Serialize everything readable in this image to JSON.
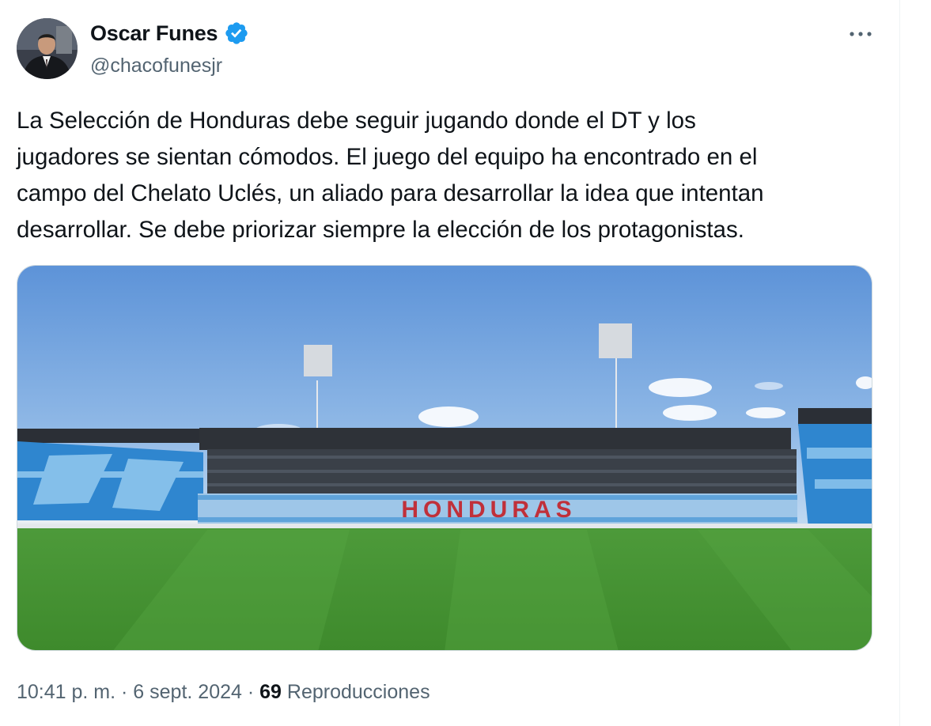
{
  "user": {
    "display_name": "Oscar Funes",
    "handle": "@chacofunesjr",
    "verified": true,
    "verified_color": "#1d9bf0"
  },
  "tweet": {
    "text": "La Selección de Honduras debe seguir jugando donde el DT y los\njugadores se sientan cómodos. El juego del equipo ha encontrado en el\ncampo del Chelato Uclés, un aliado para desarrollar la idea que intentan\ndesarrollar. Se debe priorizar siempre la elección de los protagonistas."
  },
  "media": {
    "stand_banner": "HONDURAS",
    "banner_color": "#c0303a"
  },
  "meta": {
    "time": "10:41 p. m.",
    "separator": " · ",
    "date": "6 sept. 2024",
    "views_count": "69",
    "views_label": " Reproducciones"
  },
  "icons": {
    "more": "more-options-icon",
    "verified": "verified-badge-icon"
  }
}
